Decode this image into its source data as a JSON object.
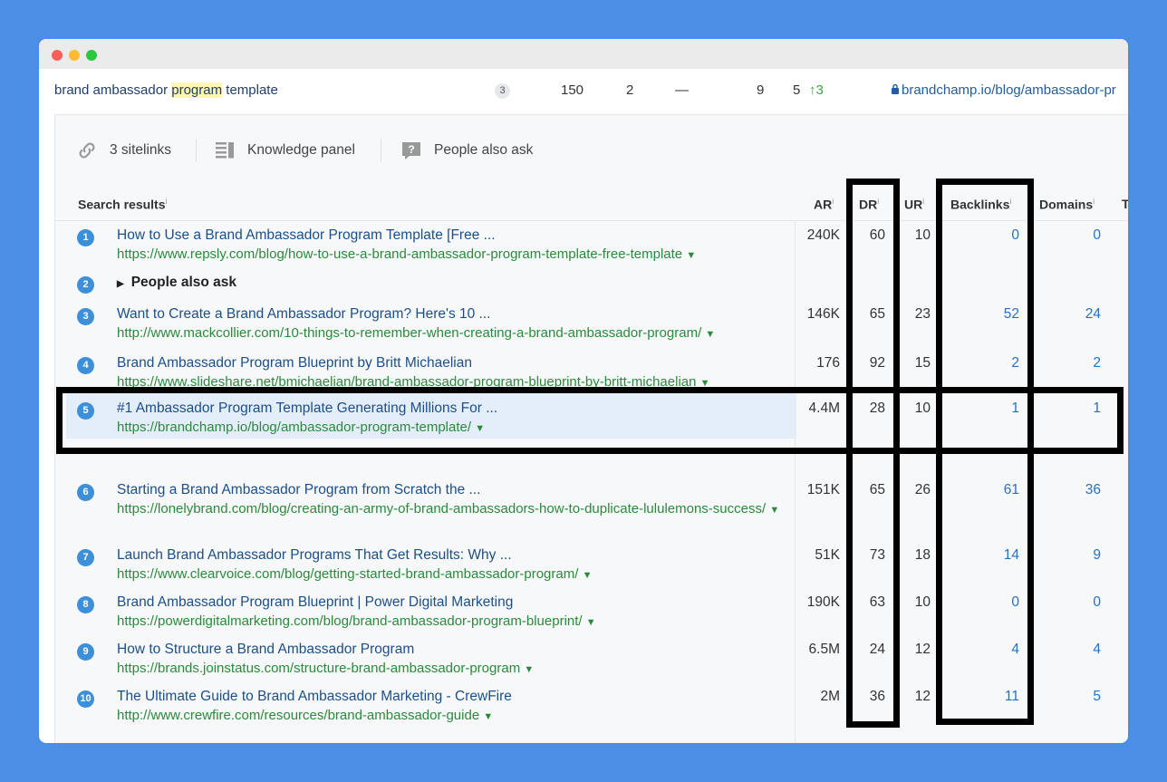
{
  "keyword_row": {
    "keyword_before": "brand ambassador ",
    "keyword_highlight": "program",
    "keyword_after": " template",
    "badge": "3",
    "volume": "150",
    "kd": "2",
    "cpc": "—",
    "clicks": "9",
    "position": "5",
    "position_change": "↑3",
    "url": "brandchamp.io/blog/ambassador-pr"
  },
  "serp_features": [
    {
      "icon": "link-icon",
      "label": "3 sitelinks"
    },
    {
      "icon": "knowledge-panel-icon",
      "label": "Knowledge panel"
    },
    {
      "icon": "question-icon",
      "label": "People also ask"
    }
  ],
  "columns": {
    "search_results": "Search results",
    "ar": "AR",
    "dr": "DR",
    "ur": "UR",
    "backlinks": "Backlinks",
    "domains": "Domains",
    "truncated": "T",
    "info_marker": "i"
  },
  "results": [
    {
      "n": "1",
      "title": "How to Use a Brand Ambassador Program Template [Free ...",
      "url": "https://www.repsly.com/blog/how-to-use-a-brand-ambassador-program-template-free-template",
      "ar": "240K",
      "dr": "60",
      "ur": "10",
      "backlinks": "0",
      "domains": "0"
    },
    {
      "n": "3",
      "title": "Want to Create a Brand Ambassador Program? Here's 10 ...",
      "url": "http://www.mackcollier.com/10-things-to-remember-when-creating-a-brand-ambassador-program/",
      "ar": "146K",
      "dr": "65",
      "ur": "23",
      "backlinks": "52",
      "domains": "24"
    },
    {
      "n": "4",
      "title": "Brand Ambassador Program Blueprint by Britt Michaelian",
      "url": "https://www.slideshare.net/bmichaelian/brand-ambassador-program-blueprint-by-britt-michaelian",
      "ar": "176",
      "dr": "92",
      "ur": "15",
      "backlinks": "2",
      "domains": "2"
    },
    {
      "n": "5",
      "title": "#1 Ambassador Program Template Generating Millions For ...",
      "url": "https://brandchamp.io/blog/ambassador-program-template/",
      "ar": "4.4M",
      "dr": "28",
      "ur": "10",
      "backlinks": "1",
      "domains": "1"
    },
    {
      "n": "6",
      "title": "Starting a Brand Ambassador Program from Scratch the ...",
      "url": "https://lonelybrand.com/blog/creating-an-army-of-brand-ambassadors-how-to-duplicate-lululemons-success/",
      "ar": "151K",
      "dr": "65",
      "ur": "26",
      "backlinks": "61",
      "domains": "36"
    },
    {
      "n": "7",
      "title": "Launch Brand Ambassador Programs That Get Results: Why ...",
      "url": "https://www.clearvoice.com/blog/getting-started-brand-ambassador-program/",
      "ar": "51K",
      "dr": "73",
      "ur": "18",
      "backlinks": "14",
      "domains": "9"
    },
    {
      "n": "8",
      "title": "Brand Ambassador Program Blueprint | Power Digital Marketing",
      "url": "https://powerdigitalmarketing.com/blog/brand-ambassador-program-blueprint/",
      "ar": "190K",
      "dr": "63",
      "ur": "10",
      "backlinks": "0",
      "domains": "0"
    },
    {
      "n": "9",
      "title": "How to Structure a Brand Ambassador Program",
      "url": "https://brands.joinstatus.com/structure-brand-ambassador-program",
      "ar": "6.5M",
      "dr": "24",
      "ur": "12",
      "backlinks": "4",
      "domains": "4"
    },
    {
      "n": "10",
      "title": "The Ultimate Guide to Brand Ambassador Marketing - CrewFire",
      "url": "http://www.crewfire.com/resources/brand-ambassador-guide",
      "ar": "2M",
      "dr": "36",
      "ur": "12",
      "backlinks": "11",
      "domains": "5"
    }
  ],
  "people_also_ask": {
    "n": "2",
    "label": "People also ask"
  },
  "colors": {
    "background": "#4a8ee6",
    "accent": "#3d8fd9",
    "url": "#2a8a3a",
    "highlight_row": "#e3eefa"
  }
}
